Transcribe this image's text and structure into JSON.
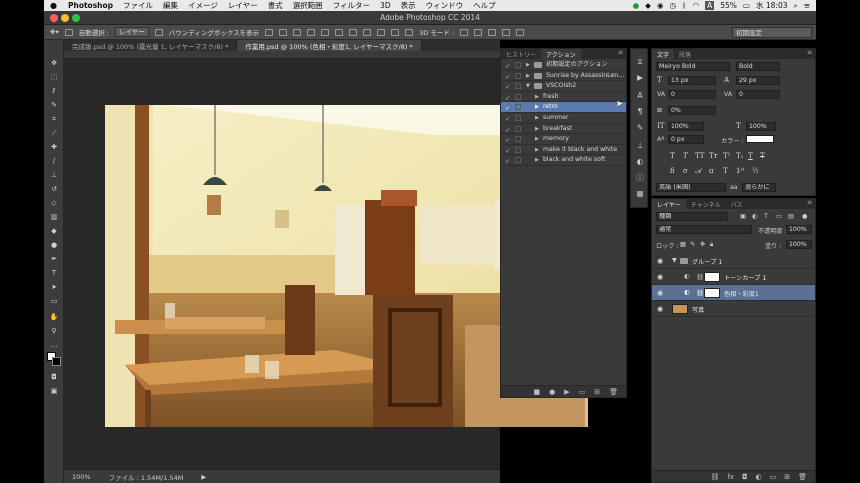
{
  "menubar": {
    "apple": "",
    "app": "Photoshop",
    "items": [
      "ファイル",
      "編集",
      "イメージ",
      "レイヤー",
      "書式",
      "選択範囲",
      "フィルター",
      "3D",
      "表示",
      "ウィンドウ",
      "ヘルプ"
    ],
    "battery": "55%",
    "clock": "水 18:03"
  },
  "window": {
    "title": "Adobe Photoshop CC 2014"
  },
  "options": {
    "auto_select_label": "自動選択 :",
    "auto_select_value": "レイヤー",
    "bounding_box_label": "バウンディングボックスを表示",
    "mode_3d": "3D モード :",
    "workspace": "初期設定"
  },
  "tabs": [
    {
      "label": "完成版.psd @ 100% (露光量 1, レイヤーマスク/8) *"
    },
    {
      "label": "作業用.psd @ 100% (色相・彩度1, レイヤーマスク/8) *"
    }
  ],
  "status": {
    "zoom": "100%",
    "file": "ファイル : 1.54M/1.54M"
  },
  "actions_panel": {
    "tab_history": "ヒストリー",
    "tab_actions": "アクション",
    "rows": [
      {
        "label": "初期設定のアクション",
        "kind": "set"
      },
      {
        "label": "Sunrise by AssassinLen...",
        "kind": "set"
      },
      {
        "label": "VSCOish2",
        "kind": "set-open"
      },
      {
        "label": "fresh",
        "kind": "action"
      },
      {
        "label": "retro",
        "kind": "action",
        "selected": true
      },
      {
        "label": "summer",
        "kind": "action"
      },
      {
        "label": "breakfast",
        "kind": "action"
      },
      {
        "label": "memory",
        "kind": "action"
      },
      {
        "label": "make it black and white",
        "kind": "action"
      },
      {
        "label": "black and white soft",
        "kind": "action"
      }
    ]
  },
  "char_panel": {
    "tab_character": "文字",
    "tab_paragraph": "段落",
    "font_family": "Meiryo Bold",
    "font_style": "Bold",
    "font_size": "13 px",
    "leading": "29 px",
    "kerning": "0",
    "tracking": "0",
    "tsume": "0%",
    "vscale": "100%",
    "hscale": "100%",
    "baseline": "0 px",
    "color_label": "カラー :",
    "language": "英語 (米国)",
    "antialias": "滑らかに",
    "aa_prefix": "aa"
  },
  "layers_panel": {
    "tab_layers": "レイヤー",
    "tab_channels": "チャンネル",
    "tab_paths": "パス",
    "filter": "種類",
    "blend_mode": "通常",
    "opacity_label": "不透明度 :",
    "opacity": "100%",
    "lock_label": "ロック :",
    "fill_label": "塗り :",
    "fill": "100%",
    "layers": [
      {
        "name": "グループ 1",
        "kind": "group"
      },
      {
        "name": "トーンカーブ 1",
        "kind": "adjustment"
      },
      {
        "name": "色相・彩度1",
        "kind": "adjustment",
        "selected": true
      },
      {
        "name": "写真",
        "kind": "image"
      }
    ]
  },
  "colors": {
    "selection_blue": "#5b7ab0",
    "panel_bg": "#3a3a3a",
    "canvas_bg": "#282828"
  }
}
